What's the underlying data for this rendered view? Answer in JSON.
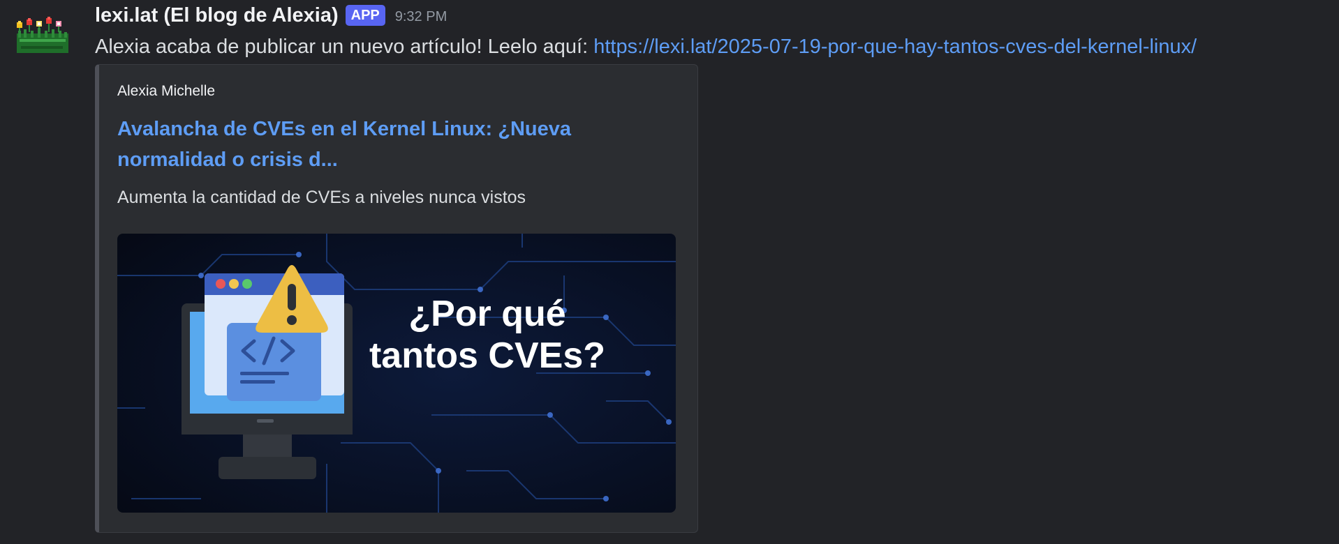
{
  "message": {
    "username": "lexi.lat (El blog de Alexia)",
    "badge": "APP",
    "timestamp": "9:32 PM",
    "text_prefix": "Alexia acaba de publicar un nuevo artículo! Leelo aquí: ",
    "link": "https://lexi.lat/2025-07-19-por-que-hay-tantos-cves-del-kernel-linux/"
  },
  "embed": {
    "author": "Alexia Michelle",
    "title": "Avalancha de CVEs en el Kernel Linux: ¿Nueva normalidad o crisis d...",
    "description": "Aumenta la cantidad de CVEs a niveles nunca vistos",
    "image": {
      "headline_line1": "¿Por qué",
      "headline_line2": "tantos CVEs?"
    }
  },
  "colors": {
    "background": "#222327",
    "link": "#5e9df5",
    "badge": "#5865f2",
    "embed_bg": "#2b2d31"
  },
  "icons": {
    "avatar": "pixel-flowers-avatar",
    "image_computer": "computer-icon",
    "image_warning": "warning-icon",
    "image_code": "code-icon"
  }
}
